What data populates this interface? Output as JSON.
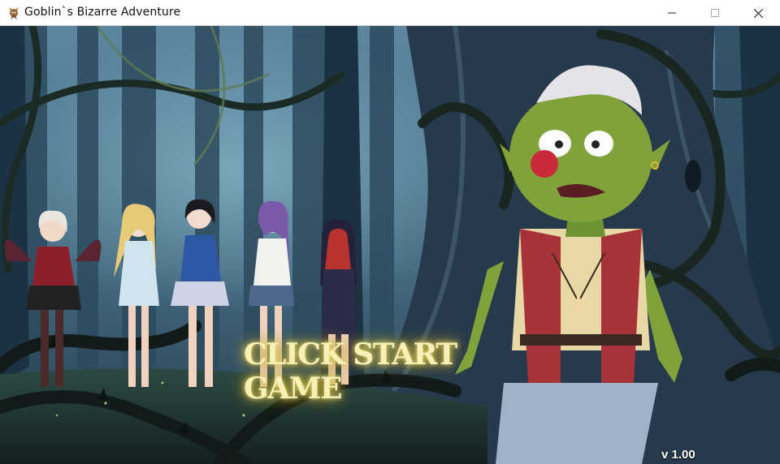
{
  "window": {
    "title": "Goblin`s Bizarre Adventure",
    "icon": "goblin-app-icon",
    "controls": {
      "minimize": "minimize-icon",
      "maximize": "maximize-icon",
      "close": "close-icon"
    }
  },
  "scene": {
    "start_prompt": "CLICK START GAME",
    "version": "v 1.00"
  },
  "colors": {
    "forest_dark": "#1e3346",
    "forest_mid": "#3f6478",
    "prompt_glow": "#e9d96a",
    "goblin_skin": "#7fa33a",
    "vest_red": "#a8323a"
  }
}
